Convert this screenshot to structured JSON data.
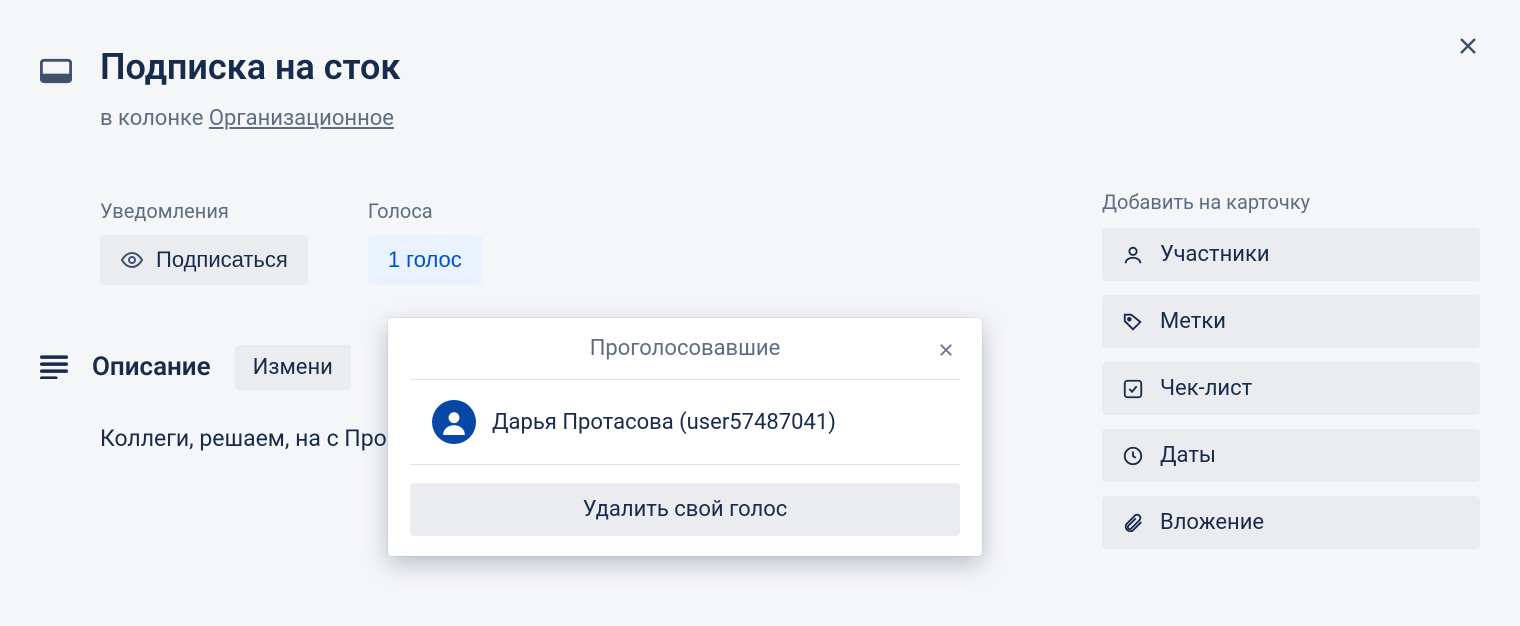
{
  "card": {
    "title": "Подписка на сток",
    "in_list_prefix": "в колонке ",
    "list_name": "Организационное",
    "vote_text": "1 голос",
    "description": "Коллеги, решаем, на с\nПроголосуйте, если ва                                                                             я чего\nиспользуете"
  },
  "sections": {
    "notifications": "Уведомления",
    "votes": "Голоса",
    "description": "Описание"
  },
  "buttons": {
    "subscribe": "Подписаться",
    "edit_partial": "Измени"
  },
  "sidebar": {
    "title": "Добавить на карточку",
    "items": [
      "Участники",
      "Метки",
      "Чек-лист",
      "Даты",
      "Вложение"
    ]
  },
  "popover": {
    "title": "Проголосовавшие",
    "voters": [
      "Дарья Протасова (user57487041)"
    ],
    "remove_vote": "Удалить свой голос"
  }
}
